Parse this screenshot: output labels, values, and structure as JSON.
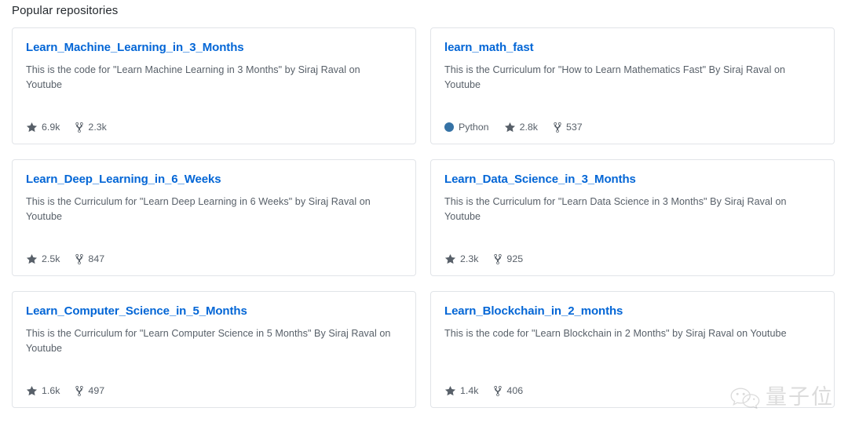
{
  "section": {
    "title": "Popular repositories"
  },
  "icons": {
    "star": "star-icon",
    "fork": "repo-forked-icon",
    "language_dot": "language-color-dot"
  },
  "colors": {
    "link": "#0366d6",
    "text": "#24292e",
    "muted": "#586069",
    "card_border": "#e1e4e8",
    "background": "#ffffff",
    "python": "#3572a5",
    "watermark": "#8b8b8b"
  },
  "repositories": [
    {
      "name": "Learn_Machine_Learning_in_3_Months",
      "description": "This is the code for \"Learn Machine Learning in 3 Months\" by Siraj Raval on Youtube",
      "language": null,
      "language_color": null,
      "stars": "6.9k",
      "forks": "2.3k"
    },
    {
      "name": "learn_math_fast",
      "description": "This is the Curriculum for \"How to Learn Mathematics Fast\" By Siraj Raval on Youtube",
      "language": "Python",
      "language_color": "#3572a5",
      "stars": "2.8k",
      "forks": "537"
    },
    {
      "name": "Learn_Deep_Learning_in_6_Weeks",
      "description": "This is the Curriculum for \"Learn Deep Learning in 6 Weeks\" by Siraj Raval on Youtube",
      "language": null,
      "language_color": null,
      "stars": "2.5k",
      "forks": "847"
    },
    {
      "name": "Learn_Data_Science_in_3_Months",
      "description": "This is the Curriculum for \"Learn Data Science in 3 Months\" By Siraj Raval on Youtube",
      "language": null,
      "language_color": null,
      "stars": "2.3k",
      "forks": "925"
    },
    {
      "name": "Learn_Computer_Science_in_5_Months",
      "description": "This is the Curriculum for \"Learn Computer Science in 5 Months\" By Siraj Raval on Youtube",
      "language": null,
      "language_color": null,
      "stars": "1.6k",
      "forks": "497"
    },
    {
      "name": "Learn_Blockchain_in_2_months",
      "description": "This is the code for \"Learn Blockchain in 2 Months\" by Siraj Raval on Youtube",
      "language": null,
      "language_color": null,
      "stars": "1.4k",
      "forks": "406"
    }
  ],
  "watermark": {
    "logo": "wechat-logo",
    "text": "量子位"
  }
}
